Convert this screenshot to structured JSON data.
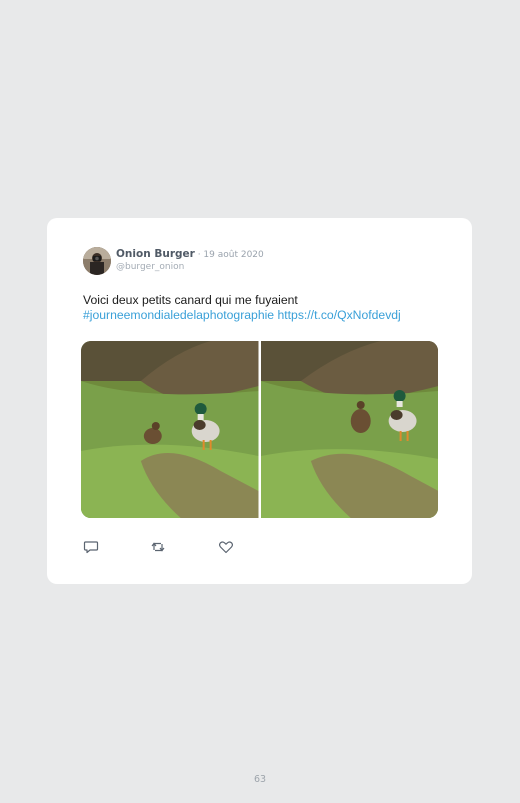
{
  "tweet": {
    "author_name": "Onion Burger",
    "date_separator": " · ",
    "date": "19 août 2020",
    "handle": "@burger_onion",
    "text": "Voici deux petits canard qui me fuyaient",
    "hashtag": "#journeemondialedelaphotographie",
    "link": "https://t.co/QxNofdevdj",
    "media": [
      {
        "subject": "two ducks on grass"
      },
      {
        "subject": "two ducks on grass"
      }
    ],
    "actions": {
      "reply_icon": "reply-icon",
      "retweet_icon": "retweet-icon",
      "like_icon": "heart-icon"
    }
  },
  "page_number": "63",
  "colors": {
    "background": "#e8e9ea",
    "card": "#ffffff",
    "link": "#3aa0d8",
    "name": "#505a66",
    "muted": "#9aa3ad"
  }
}
